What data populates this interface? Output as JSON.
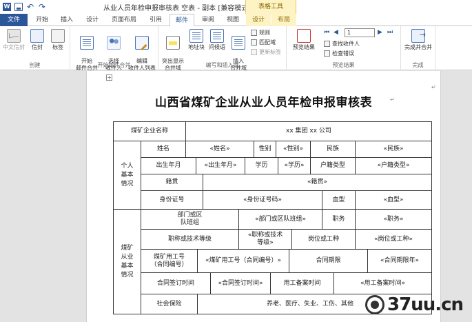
{
  "window": {
    "title": "从业人员年检申报审核表 空表 - 副本 [兼容模式] - Word",
    "context_tab_header": "表格工具"
  },
  "tabs": [
    "文件",
    "开始",
    "插入",
    "设计",
    "页面布局",
    "引用",
    "邮件",
    "审阅",
    "视图",
    "设计",
    "布局"
  ],
  "ribbon": {
    "create": {
      "label": "创建",
      "envelopes": "中文信封",
      "envelopes_en": "信封",
      "labels": "标签"
    },
    "start_merge": {
      "label": "开始邮件合并",
      "start": "开始\n邮件合并",
      "select": "选择\n收件人",
      "edit": "编辑\n收件人列表"
    },
    "write_insert": {
      "label": "编写和插入域",
      "highlight": "突出显示\n合并域",
      "address": "地址块",
      "greeting": "问候语",
      "insert_field": "插入\n合并域",
      "rules": "规则",
      "match": "匹配域",
      "update": "更新标签"
    },
    "preview": {
      "label": "预览结果",
      "preview_btn": "预览结果",
      "record": "1",
      "find": "查找收件人",
      "check": "检查错误"
    },
    "finish": {
      "label": "完成",
      "finish_btn": "完成并合并"
    }
  },
  "document": {
    "title": "山西省煤矿企业从业人员年检申报审核表",
    "rows": {
      "company_label": "煤矿企业名称",
      "company_value": "xx 集团 xx 公司",
      "personal_group": "个人\n基本\n情况",
      "name_label": "姓名",
      "name_field": "«姓名»",
      "sex_label": "性别",
      "sex_field": "«性别»",
      "ethnic_label": "民族",
      "ethnic_field": "«民族»",
      "birth_label": "出生年月",
      "birth_field": "«出生年月»",
      "edu_label": "学历",
      "edu_field": "«学历»",
      "hukou_label": "户籍类型",
      "hukou_field": "«户籍类型»",
      "native_label": "籍贯",
      "native_field": "«籍贯»",
      "id_label": "身份证号",
      "id_field": "«身份证号码»",
      "blood_label": "血型",
      "blood_field": "«血型»",
      "work_group": "煤矿\n从业\n基本\n情况",
      "dept_label": "部门或区\n队班组",
      "dept_field": "«部门或区队班组»",
      "post_label": "职务",
      "post_field": "«职务»",
      "title_label": "职称或技术等级",
      "title_field": "«职称或技术\n等级»",
      "job_label": "岗位或工种",
      "job_field": "«岗位或工种»",
      "empno_label": "煤矿用工号\n（合同编号）",
      "empno_field": "«煤矿用工号（合同编号）»",
      "term_label": "合同期限",
      "term_field": "«合同期限年»",
      "sign_label": "合同签订时间",
      "sign_field": "«合同签订时间»",
      "filing_label": "用工备案时间",
      "filing_field": "«用工备案时间»",
      "ins_label": "社会保险",
      "ins_value": "养老、医疗、失业、工伤、其他"
    }
  },
  "watermark": {
    "text": "37uu.cn"
  }
}
